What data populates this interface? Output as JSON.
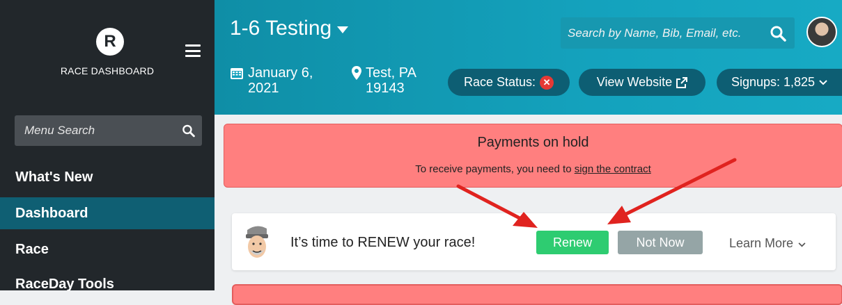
{
  "sidebar": {
    "logo_letter": "R",
    "brand": "RACE DASHBOARD",
    "menu_search_placeholder": "Menu Search",
    "items": [
      {
        "label": "What's New",
        "active": false
      },
      {
        "label": "Dashboard",
        "active": true
      },
      {
        "label": "Race",
        "active": false
      },
      {
        "label": "RaceDay Tools",
        "active": false
      }
    ]
  },
  "header": {
    "race_title": "1-6 Testing",
    "search_placeholder": "Search by Name, Bib, Email, etc.",
    "date_line1": "January 6,",
    "date_line2": "2021",
    "location_line1": "Test, PA",
    "location_line2": "19143",
    "race_status_label": "Race Status:",
    "view_website_label": "View Website",
    "signups_label": "Signups: 1,825"
  },
  "alert": {
    "title": "Payments on hold",
    "message_prefix": "To receive payments, you need to ",
    "link_text": "sign the contract"
  },
  "renew": {
    "text": "It’s time to RENEW your race!",
    "renew_button": "Renew",
    "not_now_button": "Not Now",
    "learn_more": "Learn More"
  },
  "icons": {
    "menu": "hamburger-icon",
    "search": "search-icon",
    "calendar": "calendar-icon",
    "location": "map-marker-icon",
    "status": "x-circle-icon",
    "external": "external-link-icon",
    "chevron": "chevron-down-icon"
  },
  "colors": {
    "sidebar_bg": "#22272b",
    "active_item_bg": "#0f5f73",
    "header_bg": "#14a2bd",
    "pill_bg": "#0d5e73",
    "alert_bg": "#ff7f7f",
    "renew_green": "#2ecc71",
    "not_now_gray": "#95a5a6",
    "arrow_red": "#e0231f"
  }
}
